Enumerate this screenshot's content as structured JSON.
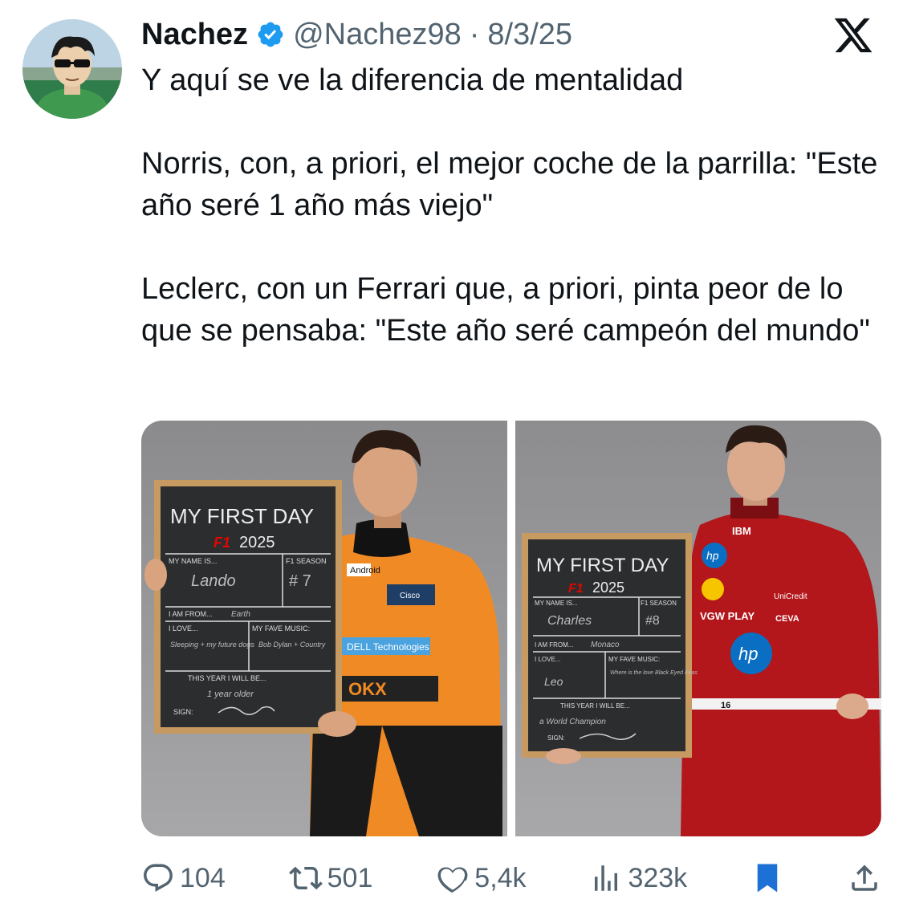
{
  "author": {
    "display_name": "Nachez",
    "handle": "@Nachez98",
    "separator": "·",
    "date": "8/3/25"
  },
  "platform_icon": "x-logo-icon",
  "body": {
    "paragraphs": [
      "Y aquí se ve la diferencia de mentalidad",
      "Norris, con, a priori, el mejor coche de la parrilla: \"Este año seré 1 año más viejo\"",
      "Leclerc, con un Ferrari que, a priori, pinta peor de lo que se pensaba: \"Este año seré campeón del mundo\""
    ]
  },
  "media": {
    "left": {
      "board": {
        "title": "MY FIRST DAY",
        "logo_text": "F1",
        "year": "2025",
        "name_label": "MY NAME IS...",
        "name_value": "Lando",
        "season_label": "F1 SEASON",
        "season_value": "# 7",
        "from_label": "I AM FROM...",
        "from_value": "Earth",
        "love_label": "I LOVE...",
        "love_value": "Sleeping + my future dogs",
        "music_label": "MY FAVE MUSIC:",
        "music_value": "Bob Dylan + Country",
        "year_label": "THIS YEAR I WILL BE...",
        "year_value": "1 year older",
        "sign_label": "SIGN:"
      },
      "suit_sponsors": [
        "Android",
        "Cisco",
        "DELL Technologies",
        "OKX"
      ]
    },
    "right": {
      "board": {
        "title": "MY FIRST DAY",
        "logo_text": "F1",
        "year": "2025",
        "name_label": "MY NAME IS...",
        "name_value": "Charles",
        "season_label": "F1 SEASON",
        "season_value": "#8",
        "from_label": "I AM FROM...",
        "from_value": "Monaco",
        "love_label": "I LOVE...",
        "love_value": "Leo",
        "music_label": "MY FAVE MUSIC:",
        "music_value": "Where is the love Black Eyed Peas",
        "year_label": "THIS YEAR I WILL BE...",
        "year_value": "a World Champion",
        "sign_label": "SIGN:"
      },
      "suit_sponsors": [
        "IBM",
        "hp",
        "Shell",
        "UniCredit",
        "VGW PLAY",
        "CEVA",
        "16"
      ]
    }
  },
  "actions": {
    "replies": "104",
    "reposts": "501",
    "likes": "5,4k",
    "views": "323k"
  },
  "colors": {
    "accent": "#1d9bf0",
    "muted": "#536471",
    "bookmark": "#1d70d6",
    "mclaren_orange": "#f08a24",
    "ferrari_red": "#b3161b",
    "chalkboard": "#2c2d2f",
    "frame": "#c79a62"
  }
}
